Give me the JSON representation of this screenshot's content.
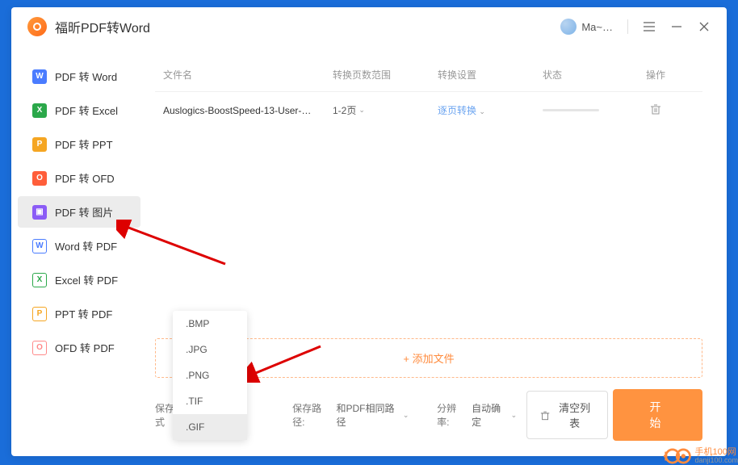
{
  "app": {
    "title": "福昕PDF转Word"
  },
  "user": {
    "name": "Ma~…"
  },
  "sidebar": {
    "items": [
      {
        "label": "PDF 转 Word"
      },
      {
        "label": "PDF 转 Excel"
      },
      {
        "label": "PDF 转 PPT"
      },
      {
        "label": "PDF 转 OFD"
      },
      {
        "label": "PDF 转 图片"
      },
      {
        "label": "Word 转 PDF"
      },
      {
        "label": "Excel 转 PDF"
      },
      {
        "label": "PPT 转 PDF"
      },
      {
        "label": "OFD 转 PDF"
      }
    ]
  },
  "table": {
    "headers": {
      "name": "文件名",
      "range": "转换页数范围",
      "settings": "转换设置",
      "status": "状态",
      "ops": "操作"
    },
    "rows": [
      {
        "name": "Auslogics-BoostSpeed-13-User-…",
        "range": "1-2页",
        "settings": "逐页转换"
      }
    ]
  },
  "dropdown": {
    "items": [
      {
        "label": ".BMP"
      },
      {
        "label": ".JPG"
      },
      {
        "label": ".PNG"
      },
      {
        "label": ".TIF"
      },
      {
        "label": ".GIF"
      }
    ]
  },
  "addFile": {
    "label": "添加文件"
  },
  "footer": {
    "formatLabel": "保存格式",
    "pathLabel": "保存路径:",
    "pathValue": "和PDF相同路径",
    "resLabel": "分辨率:",
    "resValue": "自动确定",
    "clear": "清空列表",
    "start": "开 始"
  },
  "watermark": {
    "cn": "手机100网",
    "en": "danji100.com"
  }
}
